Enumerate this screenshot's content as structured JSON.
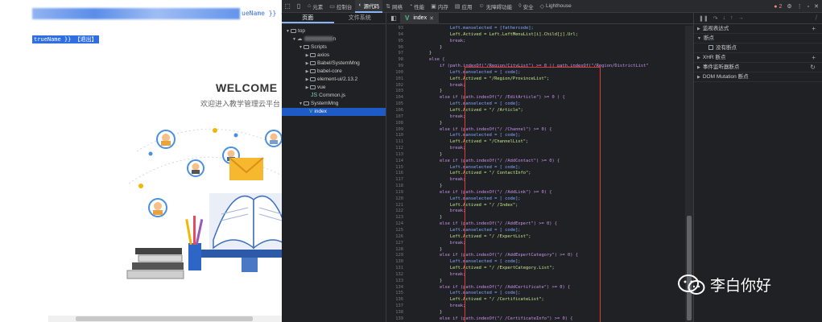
{
  "webpage": {
    "top_text": "ueName }} (",
    "user_bar": "trueName }} 【退出】",
    "welcome_title": "WELCOME",
    "welcome_subtitle": "欢迎进入教学管理云平台"
  },
  "devtools": {
    "toolbar": {
      "tabs": [
        {
          "label": "元素",
          "icon": "home-icon"
        },
        {
          "label": "控制台",
          "icon": "console-icon"
        },
        {
          "label": "源代码",
          "icon": "sources-icon",
          "active": true
        },
        {
          "label": "网络",
          "icon": "network-icon"
        },
        {
          "label": "性能",
          "icon": "performance-icon"
        },
        {
          "label": "内存",
          "icon": "memory-icon"
        },
        {
          "label": "应用",
          "icon": "application-icon"
        },
        {
          "label": "无障碍功能",
          "icon": "accessibility-icon"
        },
        {
          "label": "安全",
          "icon": "security-icon"
        },
        {
          "label": "Lighthouse",
          "icon": "lighthouse-icon"
        }
      ],
      "error_count": "2"
    },
    "sources_panel": {
      "tabs": [
        "页面",
        "文件系统"
      ],
      "tree": {
        "top": "top",
        "host": "n",
        "scripts": "Scripts",
        "scripts_children": [
          "axios",
          "Babel/SystemMng",
          "babel-core",
          "element-ui/2.13.2",
          "vue",
          "Common.js"
        ],
        "system_mng": "SystemMng",
        "selected_file": "index"
      }
    },
    "editor": {
      "tab_label": "index",
      "lines": [
        {
          "n": "93",
          "t": "                Left.manselected = [fathercode];"
        },
        {
          "n": "94",
          "t": "                Left.Actived = Left.LeftMenuList[i].Child[j].Url;"
        },
        {
          "n": "95",
          "t": "                break;"
        },
        {
          "n": "96",
          "t": "            }"
        },
        {
          "n": "97",
          "t": "        }"
        },
        {
          "n": "98",
          "t": "        else {"
        },
        {
          "n": "99",
          "t": "            if (path.indexOf(\"/Region/CityList\") >= 0 || path.indexOf(\"/Region/DistrictList\""
        },
        {
          "n": "100",
          "t": "                Left.manselected = [ code];"
        },
        {
          "n": "101",
          "t": "                Left.Actived = \"/Region/ProvinceList\";"
        },
        {
          "n": "102",
          "t": "                break;"
        },
        {
          "n": "103",
          "t": "            }"
        },
        {
          "n": "104",
          "t": "            else if (path.indexOf(\"/ /EditArticle\") >= 0 ) {"
        },
        {
          "n": "105",
          "t": "                Left.manselected = [ code];"
        },
        {
          "n": "106",
          "t": "                Left.Actived = \"/ /Article\";"
        },
        {
          "n": "107",
          "t": "                break;"
        },
        {
          "n": "108",
          "t": "            }"
        },
        {
          "n": "109",
          "t": "            else if (path.indexOf(\"/ /Channel\") >= 0) {"
        },
        {
          "n": "110",
          "t": "                Left.manselected = [ code];"
        },
        {
          "n": "111",
          "t": "                Left.Actived = \"/ChannelList\";"
        },
        {
          "n": "112",
          "t": "                break;"
        },
        {
          "n": "113",
          "t": "            }"
        },
        {
          "n": "114",
          "t": "            else if (path.indexOf(\"/ /AddContact\") >= 0) {"
        },
        {
          "n": "115",
          "t": "                Left.manselected = [ code];"
        },
        {
          "n": "116",
          "t": "                Left.Actived = \"/ ContactInfo\";"
        },
        {
          "n": "117",
          "t": "                break;"
        },
        {
          "n": "118",
          "t": "            }"
        },
        {
          "n": "119",
          "t": "            else if (path.indexOf(\"/ /AddLink\") >= 0) {"
        },
        {
          "n": "120",
          "t": "                Left.manselected = [ code];"
        },
        {
          "n": "121",
          "t": "                Left.Actived = \"/ /Index\";"
        },
        {
          "n": "122",
          "t": "                break;"
        },
        {
          "n": "123",
          "t": "            }"
        },
        {
          "n": "124",
          "t": "            else if (path.indexOf(\"/ /AddExpert\") >= 0) {"
        },
        {
          "n": "125",
          "t": "                Left.manselected = [ code];"
        },
        {
          "n": "126",
          "t": "                Left.Actived = \"/ /ExpertList\";"
        },
        {
          "n": "127",
          "t": "                break;"
        },
        {
          "n": "128",
          "t": "            }"
        },
        {
          "n": "129",
          "t": "            else if (path.indexOf(\"/ /AddExpertCategory\") >= 0) {"
        },
        {
          "n": "130",
          "t": "                Left.manselected = [ code];"
        },
        {
          "n": "131",
          "t": "                Left.Actived = \"/ /ExpertCategory.List\";"
        },
        {
          "n": "132",
          "t": "                break;"
        },
        {
          "n": "133",
          "t": "            }"
        },
        {
          "n": "134",
          "t": "            else if (path.indexOf(\"/ /AddCertificate\") >= 0) {"
        },
        {
          "n": "135",
          "t": "                Left.manselected = [ code];"
        },
        {
          "n": "136",
          "t": "                Left.Actived = \"/ /CertificateList\";"
        },
        {
          "n": "137",
          "t": "                break;"
        },
        {
          "n": "138",
          "t": "            }"
        },
        {
          "n": "139",
          "t": "            else if (path.indexOf(\"/ /CertificateInfo\") >= 0) {"
        }
      ]
    },
    "debugger": {
      "items": [
        {
          "label": "监视表达式",
          "type": "section"
        },
        {
          "label": "断点",
          "type": "section"
        },
        {
          "label": "没有断点",
          "type": "checkbox"
        },
        {
          "label": "XHR 断点",
          "type": "section"
        },
        {
          "label": "事件监听器断点",
          "type": "section"
        },
        {
          "label": "DOM Mutation 断点",
          "type": "section"
        }
      ]
    },
    "colors": {
      "accent": "#8ab4f8",
      "highlight_box": "#e53935",
      "selected_row": "#1e5bc6"
    }
  },
  "watermark": {
    "text": "李白你好",
    "icon": "wechat-icon"
  }
}
